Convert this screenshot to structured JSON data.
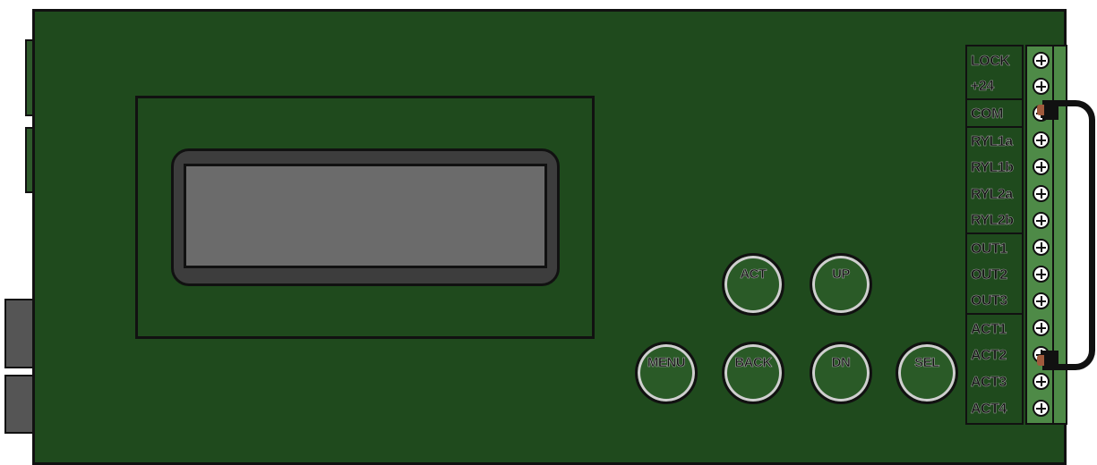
{
  "panel": {
    "buttons": {
      "act": "ACT",
      "up": "UP",
      "menu": "MENU",
      "back": "BACK",
      "dn": "DN",
      "sel": "SEL"
    },
    "terminal_labels": [
      "LOCK",
      "+24",
      "COM",
      "RYL1a",
      "RYL1b",
      "RYL2a",
      "RYL2b",
      "OUT1",
      "OUT2",
      "OUT3",
      "ACT1",
      "ACT2",
      "ACT3",
      "ACT4"
    ],
    "jumper": {
      "from": "COM",
      "to": "ACT2"
    }
  },
  "colors": {
    "board": "#1f4a1d",
    "lcd_screen": "#6b6b6b",
    "lcd_frame": "#3d3d3d",
    "terminal_block": "#4e8a47",
    "outline": "#111111"
  }
}
